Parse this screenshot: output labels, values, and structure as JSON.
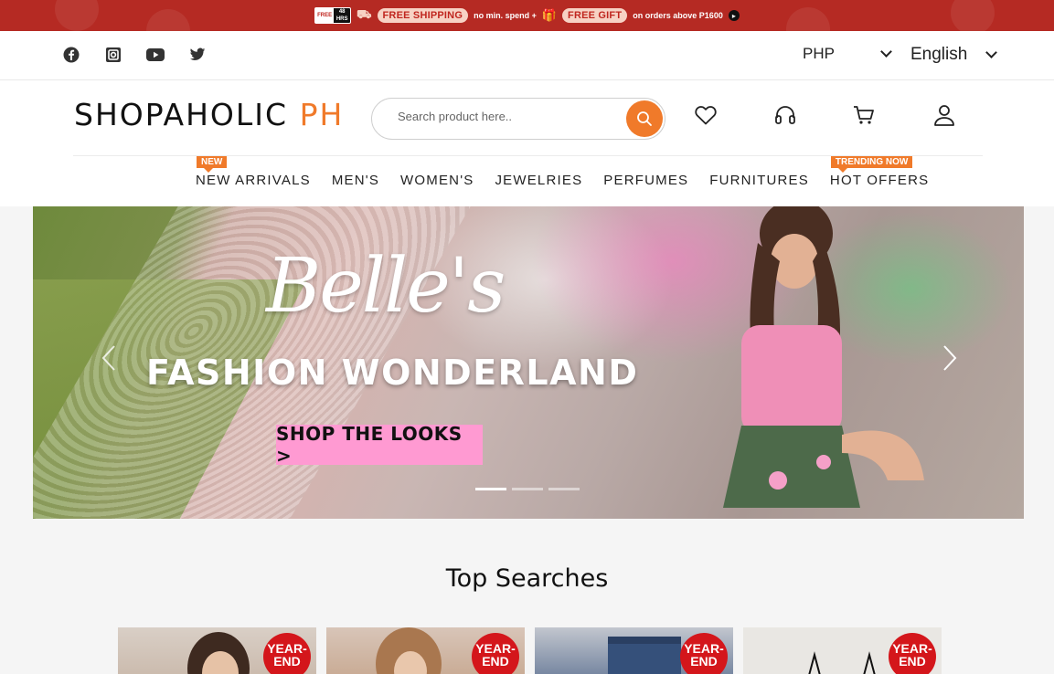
{
  "promo": {
    "badge_left": "FREE",
    "badge_right": "48 HRS",
    "free_shipping": "FREE SHIPPING",
    "no_min": "no min. spend +",
    "free_gift": "FREE GIFT",
    "orders_above": "on orders above P1600"
  },
  "utility": {
    "currency": "PHP",
    "language": "English"
  },
  "header": {
    "logo_main": "SHOPAHOLIC",
    "logo_accent": "PH",
    "search_placeholder": "Search product here.."
  },
  "nav": {
    "new_tag": "NEW",
    "trending_tag": "TRENDING NOW",
    "items": [
      "NEW ARRIVALS",
      "MEN'S",
      "WOMEN'S",
      "JEWELRIES",
      "PERFUMES",
      "FURNITURES",
      "HOT OFFERS"
    ]
  },
  "hero": {
    "script_title": "Belle's",
    "headline": "FASHION WONDERLAND",
    "cta": "SHOP THE LOOKS >"
  },
  "top_searches": {
    "title": "Top Searches",
    "badge_line1": "YEAR-",
    "badge_line2": "END"
  },
  "colors": {
    "promo_bg": "#b52a23",
    "accent": "#f07a2a",
    "cta_bg": "#ff9ad2",
    "sale_badge": "#d4161b"
  }
}
